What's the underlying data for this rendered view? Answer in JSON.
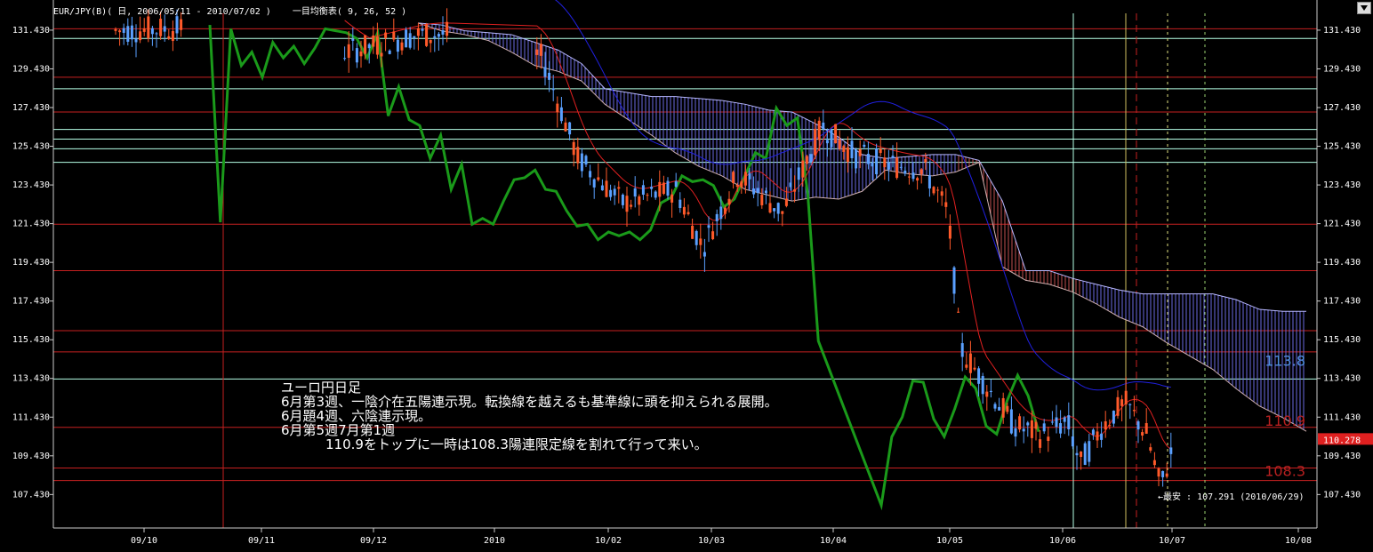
{
  "header": {
    "symbol": "EUR/JPY(B)( 日, 2006/05/11 - 2010/07/02 )",
    "indicator": "一目均衡表( 9, 26, 52 )"
  },
  "note": {
    "lines": [
      "ユーロ円日足",
      "6月第3週、一陰介在五陽連示現。転換線を越えるも基準線に頭を抑えられる展開。",
      "6月題4週、六陰連示現。",
      "6月第5週7月第1週",
      "110.9をトップに一時は108.3陽連限定線を割れて行って来い。"
    ]
  },
  "chart_data": {
    "type": "candlestick-ichimoku",
    "ylim": [
      105.7,
      132.3
    ],
    "y_ticks": [
      "131.430",
      "129.430",
      "127.430",
      "125.430",
      "123.430",
      "121.430",
      "119.430",
      "117.430",
      "115.430",
      "113.430",
      "111.430",
      "109.430",
      "107.430"
    ],
    "x_ticks": [
      "09/10",
      "09/11",
      "09/12",
      "2010",
      "10/02",
      "10/03",
      "10/04",
      "10/05",
      "10/06",
      "10/07",
      "10/08"
    ],
    "last_price": "110.278",
    "low_annotation": "←最安 : 107.291 (2010/06/29)",
    "level_labels": [
      {
        "text": "113.8",
        "value": 113.8,
        "color": "#4f8fe0"
      },
      {
        "text": "110.9",
        "value": 110.9,
        "color": "#b82020"
      },
      {
        "text": "108.3",
        "value": 108.3,
        "color": "#b82020"
      }
    ],
    "red_hlines": [
      131.5,
      129.0,
      127.2,
      121.4,
      119.0,
      115.9,
      114.8,
      110.9,
      108.8,
      108.15
    ],
    "cyan_hlines": [
      131.0,
      128.4,
      126.3,
      125.8,
      125.3,
      124.6,
      113.4
    ],
    "red_vline_x": "09/11-mid",
    "colors": {
      "up": "#ff5a2a",
      "down": "#5aa0ff",
      "tenkan": "#e02020",
      "kijun": "#2020e0",
      "chikou": "#1a9a1a",
      "cloud_bull": "#6a6adf",
      "cloud_bear": "#c05050",
      "grid_red": "#c62020",
      "grid_cyan": "#b5ffe6",
      "last_box": "#e02020"
    },
    "cloud_series": [
      [
        131.8,
        131.8
      ],
      [
        131.7,
        131.4
      ],
      [
        131.4,
        131.2
      ],
      [
        131.3,
        130.9
      ],
      [
        131.2,
        130.3
      ],
      [
        130.8,
        129.6
      ],
      [
        130.4,
        129.3
      ],
      [
        129.7,
        128.8
      ],
      [
        128.4,
        127.6
      ],
      [
        128.2,
        126.8
      ],
      [
        128.0,
        126.0
      ],
      [
        128.0,
        125.1
      ],
      [
        127.9,
        124.4
      ],
      [
        127.8,
        123.9
      ],
      [
        127.6,
        123.2
      ],
      [
        127.3,
        122.9
      ],
      [
        127.2,
        122.6
      ],
      [
        126.6,
        122.8
      ],
      [
        125.9,
        122.7
      ],
      [
        125.0,
        123.1
      ],
      [
        124.8,
        124.2
      ],
      [
        124.9,
        124.0
      ],
      [
        125.0,
        123.9
      ],
      [
        125.0,
        124.1
      ],
      [
        124.7,
        124.6
      ],
      [
        122.6,
        119.2
      ],
      [
        119.0,
        118.5
      ],
      [
        119.0,
        118.3
      ],
      [
        118.6,
        117.9
      ],
      [
        118.3,
        117.3
      ],
      [
        118.0,
        116.6
      ],
      [
        117.8,
        116.1
      ],
      [
        117.8,
        115.3
      ],
      [
        117.8,
        114.6
      ],
      [
        117.8,
        113.9
      ],
      [
        117.5,
        112.9
      ],
      [
        117.0,
        112.0
      ],
      [
        116.9,
        111.4
      ],
      [
        116.9,
        110.7
      ]
    ],
    "chikou_series": [
      [
        131.7,
        121.5
      ],
      [
        131.5,
        129.6
      ],
      [
        130.3,
        129.0
      ],
      [
        130.8,
        130.0
      ],
      [
        130.6,
        129.7
      ],
      [
        130.5,
        131.5
      ],
      [
        131.4,
        131.3
      ],
      [
        131.0,
        130.0
      ],
      [
        131.3,
        127.0
      ],
      [
        128.5,
        126.8
      ],
      [
        126.5,
        124.8
      ],
      [
        126.0,
        123.2
      ],
      [
        124.5,
        121.4
      ],
      [
        121.7,
        121.4
      ],
      [
        122.6,
        123.7
      ],
      [
        123.8,
        124.2
      ],
      [
        123.2,
        123.1
      ],
      [
        122.1,
        121.3
      ],
      [
        121.4,
        120.6
      ],
      [
        121.0,
        120.8
      ],
      [
        121.0,
        120.6
      ],
      [
        121.1,
        122.5
      ],
      [
        122.8,
        123.9
      ],
      [
        123.6,
        123.7
      ],
      [
        123.4,
        122.3
      ],
      [
        122.7,
        123.9
      ],
      [
        125.1,
        124.8
      ],
      [
        127.4,
        126.5
      ],
      [
        126.9,
        125.6
      ],
      [
        125.4,
        124.8
      ],
      [
        125.5,
        127.8
      ],
      [
        125.6,
        122.9
      ],
      [
        122.0,
        121.6
      ],
      [
        124.7,
        124.4
      ],
      [
        125.0,
        123.2
      ],
      [
        124.2,
        125.5
      ],
      [
        125.3,
        124.5
      ],
      [
        124.3,
        124.6
      ],
      [
        124.5,
        124.1
      ],
      [
        123.8,
        121.5
      ]
    ]
  }
}
